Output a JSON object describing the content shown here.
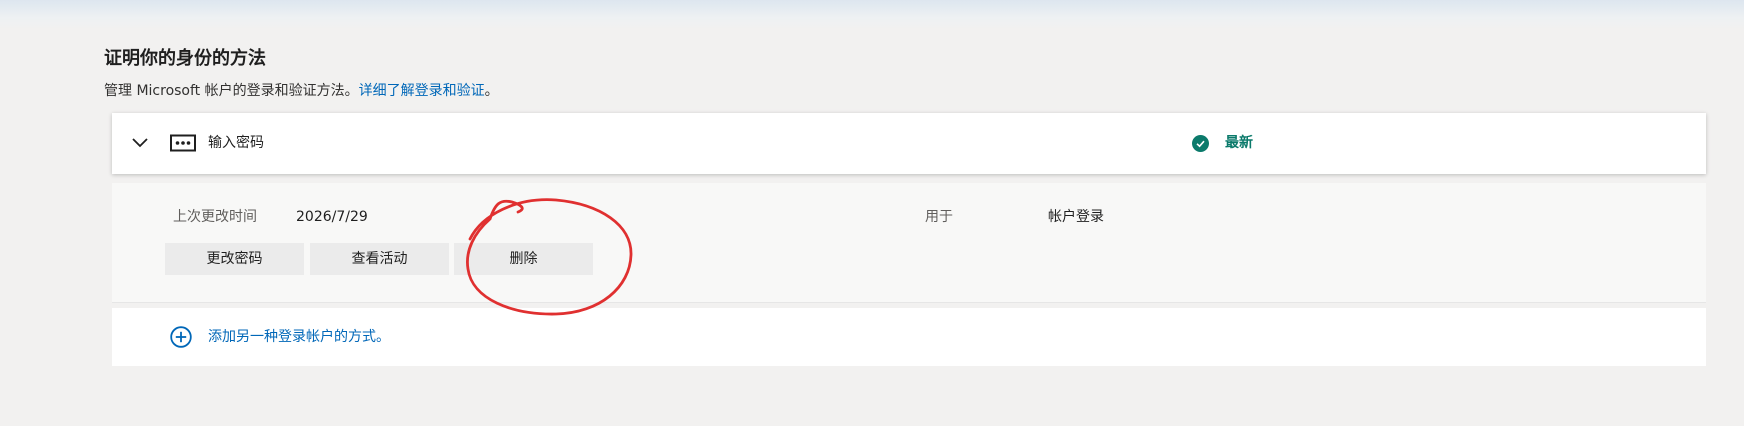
{
  "section": {
    "title": "证明你的身份的方法",
    "description_prefix": "管理 Microsoft 帐户的登录和验证方法。",
    "description_link": "详细了解登录和验证",
    "description_suffix": "。"
  },
  "method": {
    "label": "输入密码",
    "status": "最新",
    "icons": {
      "toggle": "chevron-down-icon",
      "method": "password-icon",
      "status": "checkmark-circle-icon"
    }
  },
  "details": {
    "last_changed_label": "上次更改时间",
    "last_changed_value": "2026/7/29",
    "used_for_label": "用于",
    "used_for_value": "帐户登录",
    "buttons": {
      "change_password": "更改密码",
      "view_activity": "查看活动",
      "delete": "删除"
    }
  },
  "add_method": {
    "label": "添加另一种登录帐户的方式。",
    "icon": "plus-circle-icon"
  },
  "colors": {
    "link": "#0067b8",
    "status": "#0b7a6b",
    "annotation": "#e03030"
  }
}
